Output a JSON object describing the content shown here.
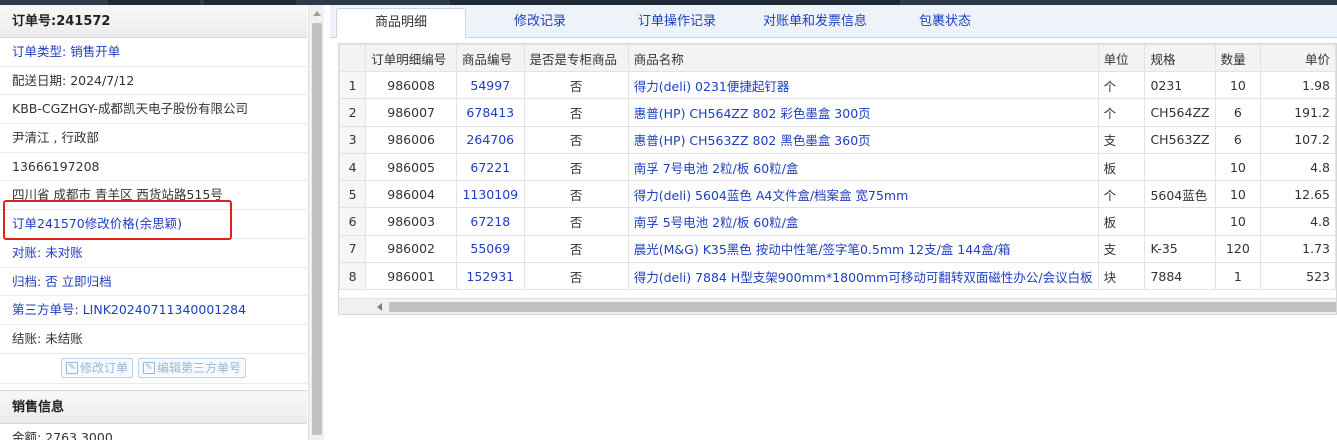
{
  "order": {
    "title": "订单号:241572",
    "rows": [
      {
        "label": "订单类型: ",
        "value": "销售开单"
      },
      {
        "label": "配送日期: ",
        "value": "2024/7/12"
      },
      {
        "label": "",
        "value": "KBB-CGZHGY-成都凯天电子股份有限公司"
      },
      {
        "label": "",
        "value": "尹清江 , 行政部"
      },
      {
        "label": "",
        "value": "13666197208"
      },
      {
        "label": "",
        "value": "四川省 成都市 青羊区 西货站路515号"
      },
      {
        "label": "",
        "value": "订单241570修改价格(余思颖)"
      },
      {
        "label": "对账: ",
        "value": "未对账"
      },
      {
        "label": "归档: ",
        "value": "否 立即归档"
      },
      {
        "label": "第三方单号: ",
        "value": "LINK20240711340001284"
      },
      {
        "label": "结账: ",
        "value": "未结账"
      }
    ],
    "buttons": {
      "edit_order": "修改订单",
      "edit_third_party": "编辑第三方单号"
    },
    "sales_section": "销售信息",
    "amount": "金额: 2763.3000"
  },
  "tabs": [
    "商品明细",
    "修改记录",
    "订单操作记录",
    "对账单和发票信息",
    "包裹状态"
  ],
  "table": {
    "headers": [
      "",
      "订单明细编号",
      "商品编号",
      "是否是专柜商品",
      "商品名称",
      "单位",
      "规格",
      "数量",
      "单价"
    ],
    "rows": [
      [
        "1",
        "986008",
        "54997",
        "否",
        "得力(deli) 0231便捷起钉器",
        "个",
        "0231",
        "10",
        "1.98"
      ],
      [
        "2",
        "986007",
        "678413",
        "否",
        "惠普(HP) CH564ZZ 802 彩色墨盒 300页",
        "个",
        "CH564ZZ",
        "6",
        "191.2"
      ],
      [
        "3",
        "986006",
        "264706",
        "否",
        "惠普(HP) CH563ZZ 802 黑色墨盒 360页",
        "支",
        "CH563ZZ",
        "6",
        "107.2"
      ],
      [
        "4",
        "986005",
        "67221",
        "否",
        "南孚 7号电池 2粒/板 60粒/盒",
        "板",
        "",
        "10",
        "4.8"
      ],
      [
        "5",
        "986004",
        "1130109",
        "否",
        "得力(deli) 5604蓝色 A4文件盒/档案盒 宽75mm",
        "个",
        "5604蓝色",
        "10",
        "12.65"
      ],
      [
        "6",
        "986003",
        "67218",
        "否",
        "南孚 5号电池 2粒/板 60粒/盒",
        "板",
        "",
        "10",
        "4.8"
      ],
      [
        "7",
        "986002",
        "55069",
        "否",
        "晨光(M&G) K35黑色 按动中性笔/签字笔0.5mm 12支/盒 144盒/箱",
        "支",
        "K-35",
        "120",
        "1.73"
      ],
      [
        "8",
        "986001",
        "152931",
        "否",
        "得力(deli) 7884 H型支架900mm*1800mm可移动可翻转双面磁性办公/会议白板",
        "块",
        "7884",
        "1",
        "523"
      ]
    ]
  }
}
